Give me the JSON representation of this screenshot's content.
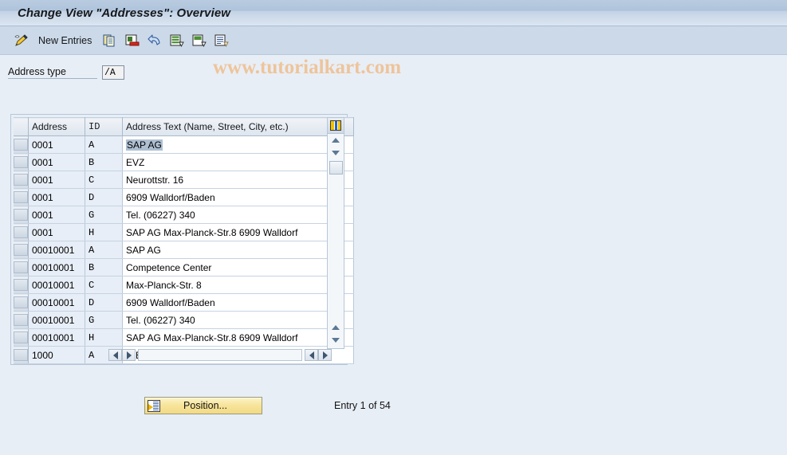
{
  "window": {
    "title": "Change View \"Addresses\": Overview"
  },
  "toolbar": {
    "edit_icon": "pencil-icon",
    "new_entries_label": "New Entries",
    "icons": [
      {
        "name": "copy-icon",
        "title": "Copy As..."
      },
      {
        "name": "delete-icon",
        "title": "Delete"
      },
      {
        "name": "undo-icon",
        "title": "Undo Change"
      },
      {
        "name": "select-all-icon",
        "title": "Select All"
      },
      {
        "name": "deselect-all-icon",
        "title": "Deselect All"
      },
      {
        "name": "details-icon",
        "title": "Details"
      }
    ],
    "watermark": "www.tutorialkart.com"
  },
  "filter": {
    "address_type_label": "Address type",
    "address_type_value": "/A"
  },
  "grid": {
    "columns": [
      {
        "key": "address",
        "label": "Address"
      },
      {
        "key": "id",
        "label": "ID"
      },
      {
        "key": "text",
        "label": "Address Text (Name, Street, City, etc.)"
      }
    ],
    "config_icon": "column-config-icon",
    "selected_cell": {
      "row": 0,
      "column": "text"
    },
    "rows": [
      {
        "address": "0001",
        "id": "A",
        "text": "SAP AG"
      },
      {
        "address": "0001",
        "id": "B",
        "text": "EVZ"
      },
      {
        "address": "0001",
        "id": "C",
        "text": "Neurottstr. 16"
      },
      {
        "address": "0001",
        "id": "D",
        "text": "6909   Walldorf/Baden"
      },
      {
        "address": "0001",
        "id": "G",
        "text": "Tel. (06227) 340"
      },
      {
        "address": "0001",
        "id": "H",
        "text": "SAP AG Max-Planck-Str.8 6909 Walldorf"
      },
      {
        "address": "00010001",
        "id": "A",
        "text": "SAP AG"
      },
      {
        "address": "00010001",
        "id": "B",
        "text": "Competence Center"
      },
      {
        "address": "00010001",
        "id": "C",
        "text": "Max-Planck-Str. 8"
      },
      {
        "address": "00010001",
        "id": "D",
        "text": "6909   Walldorf/Baden"
      },
      {
        "address": "00010001",
        "id": "G",
        "text": "Tel. (06227) 340"
      },
      {
        "address": "00010001",
        "id": "H",
        "text": "SAP AG Max-Planck-Str.8 6909 Walldorf"
      },
      {
        "address": "1000",
        "id": "A",
        "text": "IDES AG"
      }
    ]
  },
  "footer": {
    "position_button_label": "Position...",
    "entry_count_label": "Entry 1 of 54"
  },
  "colors": {
    "page_background": "#e8eef6",
    "toolbar_background": "#ccd9e8",
    "titlebar_background": "#b9cbe0",
    "watermark": "#eec49a",
    "button_yellow": "#f7e49a",
    "selection": "#aebfd2"
  }
}
